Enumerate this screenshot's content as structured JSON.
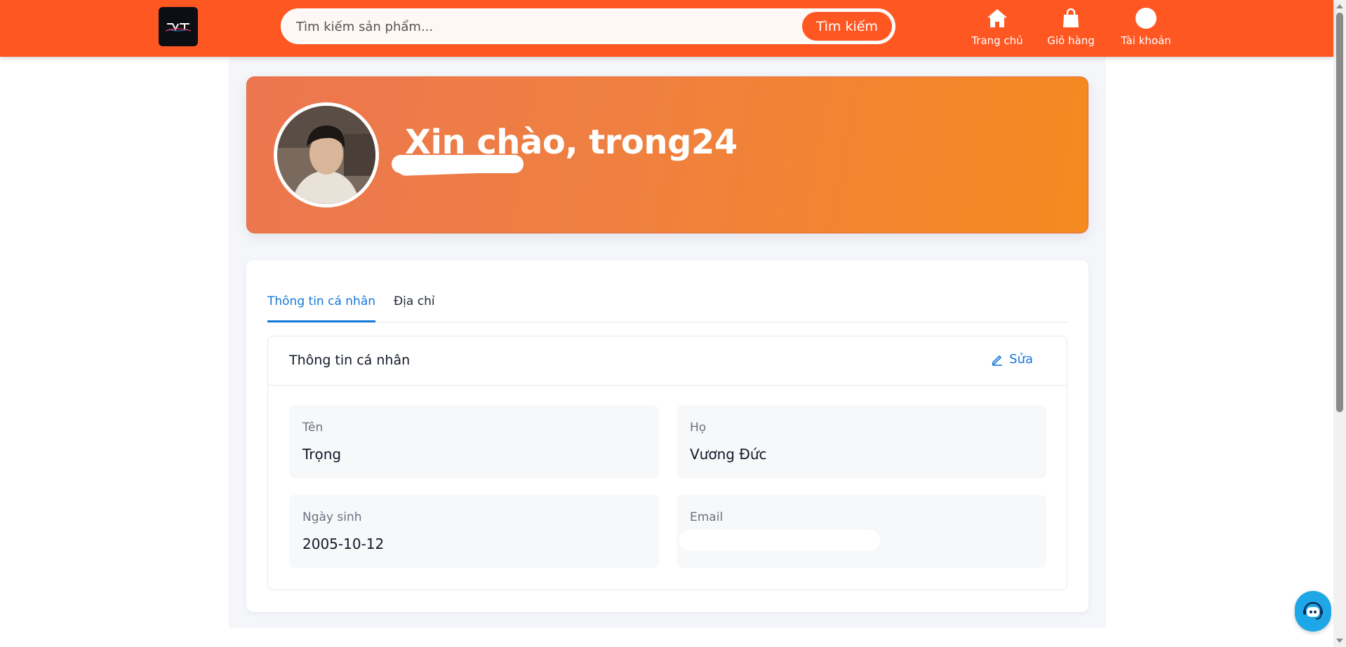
{
  "header": {
    "search_placeholder": "Tìm kiếm sản phẩm...",
    "search_button": "Tìm kiếm",
    "nav": [
      {
        "label": "Trang chủ",
        "icon": "home-icon"
      },
      {
        "label": "Giỏ hàng",
        "icon": "shopping-bag-icon"
      },
      {
        "label": "Tài khoản",
        "icon": "account-circle-icon"
      }
    ],
    "brand_color": "#ff5722"
  },
  "banner": {
    "greeting": "Xin chào, trong24"
  },
  "tabs": [
    {
      "label": "Thông tin cá nhân",
      "active": true
    },
    {
      "label": "Địa chỉ",
      "active": false
    }
  ],
  "personal_info": {
    "title": "Thông tin cá nhân",
    "edit_label": "Sửa",
    "fields": {
      "first_name": {
        "label": "Tên",
        "value": "Trọng"
      },
      "last_name": {
        "label": "Họ",
        "value": "Vương Đức"
      },
      "birthday": {
        "label": "Ngày sinh",
        "value": "2005-10-12"
      },
      "email": {
        "label": "Email",
        "value": ""
      }
    }
  },
  "colors": {
    "accent_blue": "#1677d9",
    "banner_start": "#ec7650",
    "banner_end": "#f58a20"
  }
}
